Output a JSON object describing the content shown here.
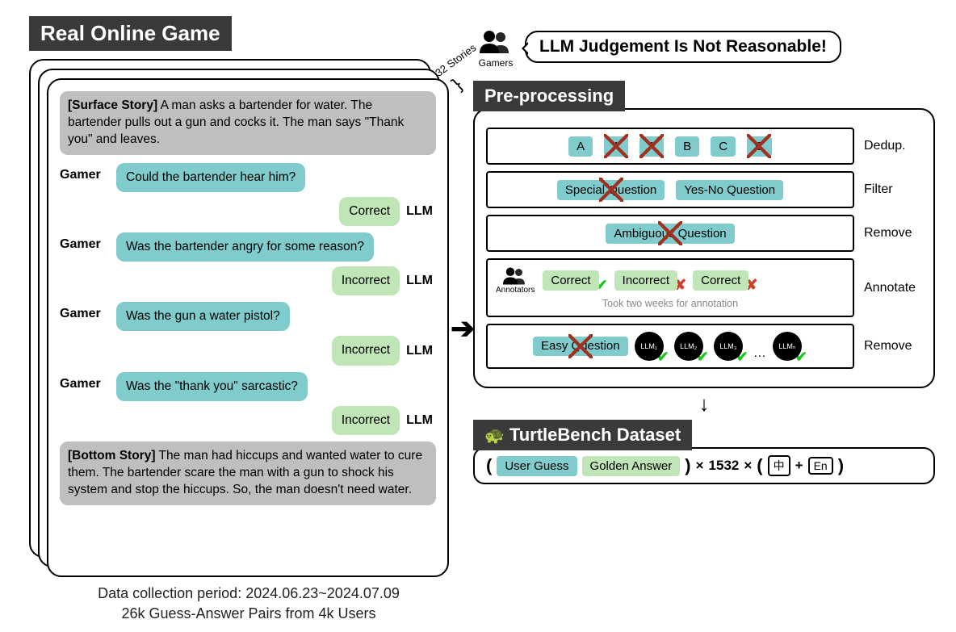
{
  "left": {
    "title": "Real Online Game",
    "stories_tag": "32 Stories",
    "surface_label": "[Surface Story]",
    "surface_text": " A man asks a bartender for water. The bartender pulls out a gun and cocks it. The man says \"Thank you\" and leaves.",
    "gamer_label": "Gamer",
    "llm_label": "LLM",
    "qas": [
      {
        "q": "Could the bartender hear him?",
        "a": "Correct"
      },
      {
        "q": "Was the bartender angry for some reason?",
        "a": "Incorrect"
      },
      {
        "q": "Was the gun a water pistol?",
        "a": "Incorrect"
      },
      {
        "q": "Was the \"thank you\" sarcastic?",
        "a": "Incorrect"
      }
    ],
    "bottom_label": "[Bottom Story]",
    "bottom_text": " The man had hiccups and wanted water to cure them. The bartender scare the man with a gun to shock his system and stop the hiccups. So, the man doesn't need water.",
    "footer_line1": "Data collection period: 2024.06.23~2024.07.09",
    "footer_line2": "26k Guess-Answer Pairs from 4k Users"
  },
  "right": {
    "gamers_label": "Gamers",
    "speech": "LLM Judgement Is Not Reasonable!",
    "preproc_title": "Pre-processing",
    "steps": {
      "dedup": {
        "label": "Dedup.",
        "items": [
          "A",
          "A",
          "A",
          "B",
          "C",
          "C"
        ],
        "crossed": [
          false,
          true,
          true,
          false,
          false,
          true
        ]
      },
      "filter": {
        "label": "Filter",
        "special": "Special Question",
        "yesno": "Yes-No Question"
      },
      "remove1": {
        "label": "Remove",
        "ambig": "Ambiguous Question"
      },
      "annotate": {
        "label": "Annotate",
        "annotators": "Annotators",
        "chips": [
          "Correct",
          "Incorrect",
          "Correct"
        ],
        "marks": [
          "check",
          "x",
          "x"
        ],
        "note": "Took two weeks for annotation"
      },
      "remove2": {
        "label": "Remove",
        "easy": "Easy Question",
        "llms": [
          "LLM₁",
          "LLM₂",
          "LLM₃",
          "LLMₙ"
        ],
        "dots": "…"
      }
    },
    "dataset": {
      "title": "TurtleBench Dataset",
      "user_guess": "User Guess",
      "golden": "Golden Answer",
      "times": "×",
      "count": "1532",
      "lang_zh": "中",
      "plus": "+",
      "lang_en": "En"
    }
  }
}
